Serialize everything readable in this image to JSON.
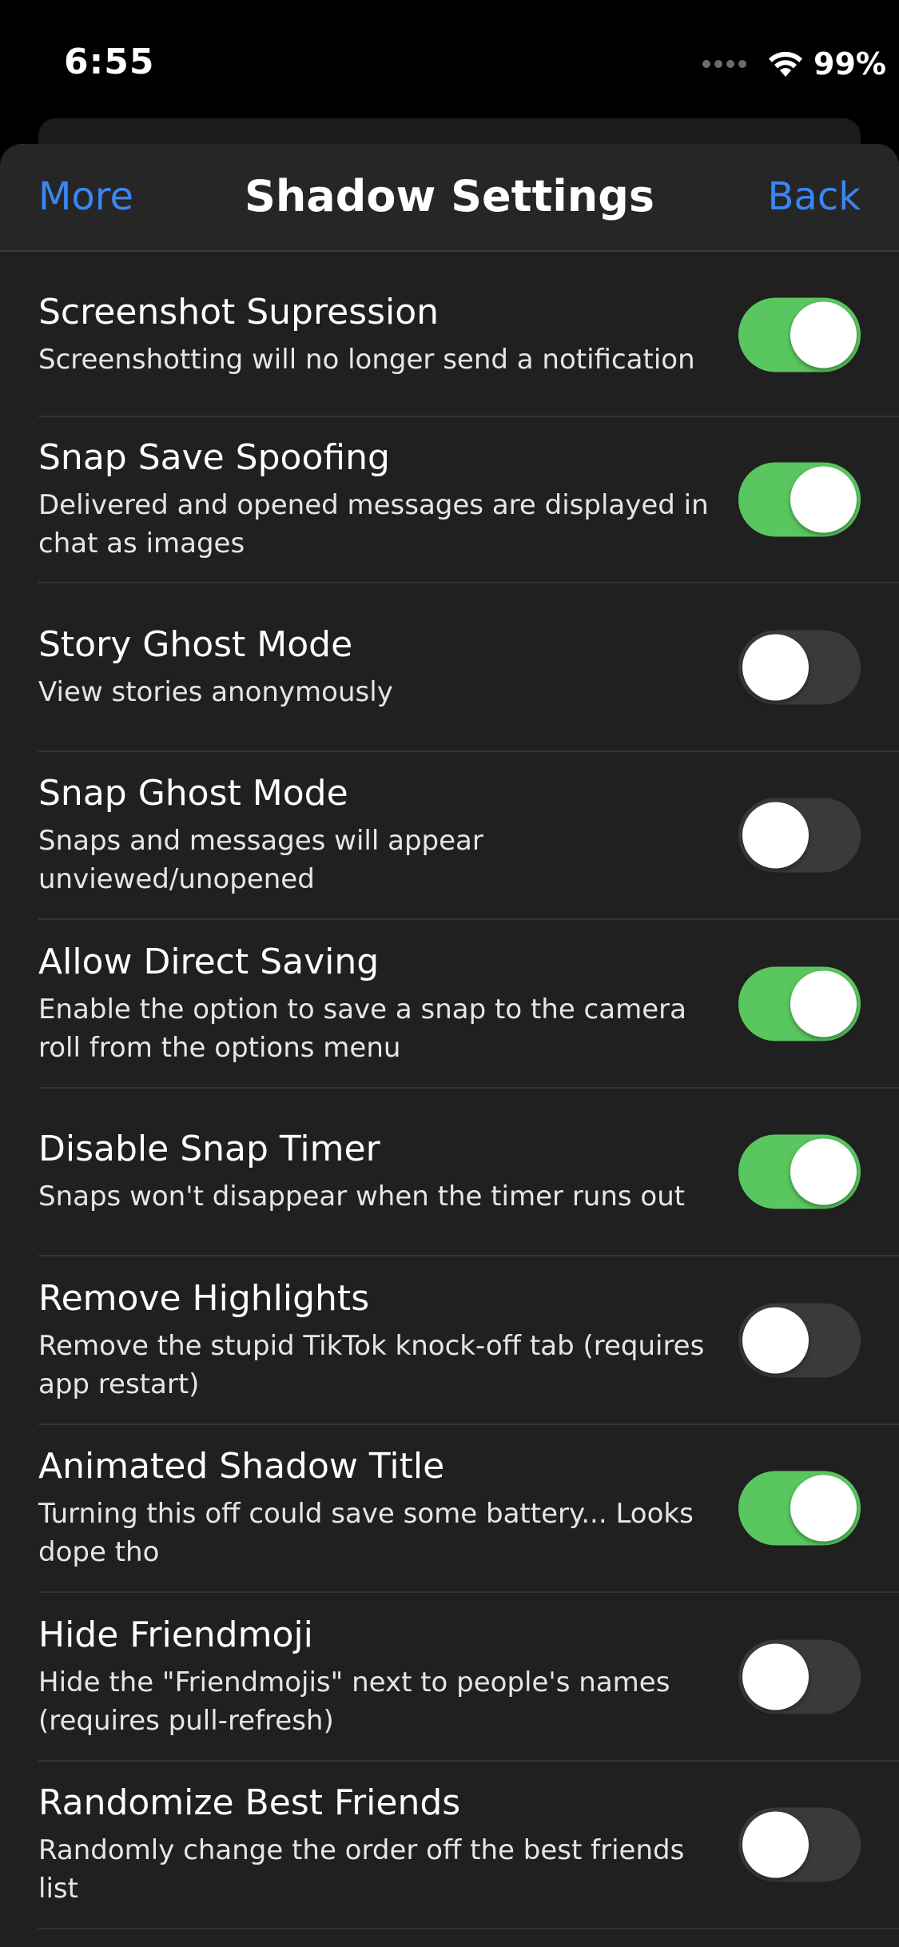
{
  "status_bar": {
    "time": "6:55",
    "battery": "99%",
    "wifi_icon": "wifi-icon"
  },
  "nav": {
    "left": "More",
    "title": "Shadow Settings",
    "right": "Back"
  },
  "colors": {
    "accent": "#3a86f3",
    "toggle_on": "#5ac65f",
    "toggle_off": "#3a3a3c",
    "background": "#202020"
  },
  "settings": [
    {
      "title": "Screenshot Supression",
      "description": "Screenshotting will no longer send a notification",
      "enabled": true
    },
    {
      "title": "Snap Save Spoofing",
      "description": "Delivered and opened messages are displayed in chat as images",
      "enabled": true
    },
    {
      "title": "Story Ghost Mode",
      "description": "View stories anonymously",
      "enabled": false
    },
    {
      "title": "Snap Ghost Mode",
      "description": "Snaps and messages will appear unviewed/unopened",
      "enabled": false
    },
    {
      "title": "Allow Direct Saving",
      "description": "Enable the option to save a snap to the camera roll from the options menu",
      "enabled": true
    },
    {
      "title": "Disable Snap Timer",
      "description": "Snaps won't disappear when the timer runs out",
      "enabled": true
    },
    {
      "title": "Remove Highlights",
      "description": "Remove the stupid TikTok knock-off tab (requires app restart)",
      "enabled": false
    },
    {
      "title": "Animated Shadow Title",
      "description": "Turning this off could save some battery... Looks dope tho",
      "enabled": true
    },
    {
      "title": "Hide Friendmoji",
      "description": "Hide the \"Friendmojis\" next to people's names (requires pull-refresh)",
      "enabled": false
    },
    {
      "title": "Randomize Best Friends",
      "description": "Randomly change the order off the best friends list",
      "enabled": false
    }
  ]
}
